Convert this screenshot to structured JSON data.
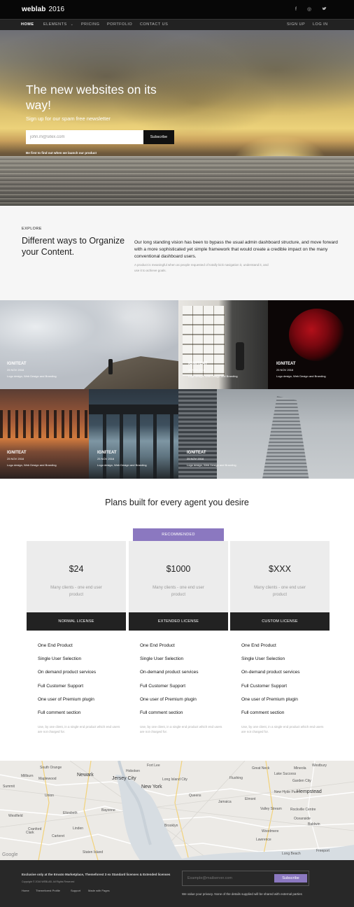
{
  "header": {
    "brand": "weblab",
    "brand_year": "2016",
    "social_icons": [
      "facebook-icon",
      "dribbble-icon",
      "twitter-icon"
    ]
  },
  "nav": {
    "items": [
      {
        "label": "HOME",
        "active": true
      },
      {
        "label": "ELEMENTS",
        "has_dropdown": true
      },
      {
        "label": "PRICING"
      },
      {
        "label": "PORTFOLIO"
      },
      {
        "label": "CONTACT US"
      }
    ],
    "right": [
      "SIGN UP",
      "LOG IN"
    ]
  },
  "hero": {
    "title": "The new websites on its way!",
    "subtitle": "Sign up for our spam free newsletter",
    "email_value": "john.m@sitex.com",
    "subscribe_label": "Subscribe",
    "note": "Be first to find out when we launch our product"
  },
  "explore": {
    "kicker": "EXPLORE",
    "title": "Different ways to Organize your Content.",
    "body": "Our long standing vision has been to bypass the usual admin dashboard structure, and move forward with a more sophisticated yet simple framework that would create a credible impact on the many conventional dashboard users.",
    "small": "A product is meaningful when as people requested of totally kick navigation it, understand it, and use it to achieve goals."
  },
  "portfolio": [
    {
      "title": "IGNITEAT",
      "date": "25 NOV 2016",
      "categories": "Logo design, Web Design and Branding"
    },
    {
      "title": "IGNITEAT",
      "date": "25 NOV 2016",
      "categories": "Logo design, Web Design and Branding"
    },
    {
      "title": "IGNITEAT",
      "date": "25 NOV 2016",
      "categories": "Logo design, Web Design and Branding"
    },
    {
      "title": "IGNITEAT",
      "date": "25 NOV 2016",
      "categories": "Logo design, Web Design and Branding"
    },
    {
      "title": "IGNITEAT",
      "date": "25 NOV 2016",
      "categories": "Logo design, Web Design and Branding"
    },
    {
      "title": "IGNITEAT",
      "date": "25 NOV 2016",
      "categories": "Logo design, Web Design and Branding"
    }
  ],
  "pricing": {
    "heading": "Plans built for every agent you desire",
    "recommended_label": "RECOMMENDED",
    "plans": [
      {
        "price": "$24",
        "desc": "Many clients - one end user product",
        "license": "NORMAL LICENSE",
        "features": [
          "One End Product",
          "Single User Selection",
          "On demand product services",
          "Full Customer Support",
          "One user of Premium plugin",
          "Full comment section"
        ],
        "note": "Use, by one client, in a single end product which end users are not charged for."
      },
      {
        "price": "$1000",
        "desc": "Many clients - one end user product",
        "license": "EXTENDED LICENSE",
        "features": [
          "One End Product",
          "Single User Selection",
          "On-demand product services",
          "Full Customer Support",
          "One user of Premium plugin",
          "Full comment section"
        ],
        "note": "Use, by one client, in a single end product which end users are not charged for."
      },
      {
        "price": "$XXX",
        "desc": "Many clients - one end user product",
        "license": "CUSTOM LICENSE",
        "features": [
          "One End Product",
          "Single User Selection",
          "On-demand product services",
          "Full Customer Support",
          "One user of Premium plugin",
          "Full comment section"
        ],
        "note": "Use, by one client, in a single end product which end users are not charged for."
      }
    ]
  },
  "map": {
    "labels": [
      "South Orange",
      "Newark",
      "Jersey City",
      "Hoboken",
      "Millburn",
      "Maplewood",
      "Summit",
      "Union",
      "Elizabeth",
      "Westfield",
      "New York",
      "Queens",
      "Long Island City",
      "Flushing",
      "Jamaica",
      "Bayonne",
      "Staten Island",
      "Brooklyn",
      "Valley Stream",
      "Hempstead",
      "Garden City",
      "Mineola",
      "Westbury",
      "Woodmere",
      "Lawrence",
      "Long Beach",
      "Rockville Centre",
      "Oceanside",
      "Baldwin",
      "Freeport",
      "Cranford",
      "Linden",
      "Clark",
      "Carteret",
      "Elmont",
      "Fort Lee",
      "Great Neck",
      "New Hyde Park",
      "Lake Success"
    ],
    "attribution": "Google"
  },
  "footer": {
    "exclusive": "Exclusive only at the Envato Marketplace, Themeforest 3 ex Standard licenses & Extended licenses",
    "copyright": "Copyright © 2016 WEBLAB. All Rights Reserved",
    "links": [
      "Home",
      "Themeforest Profile",
      "Support",
      "Made with Pages"
    ],
    "email_placeholder": "Example@mailserver.com",
    "subscribe_label": "Subscribe",
    "privacy": "We value your privacy. None of the details supplied will be shared with external parties"
  }
}
